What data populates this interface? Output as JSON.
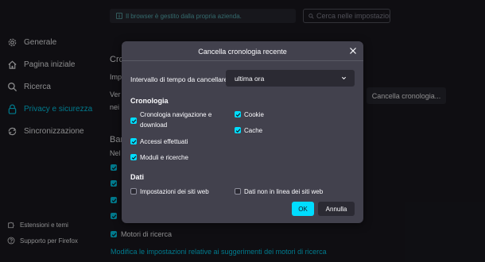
{
  "topbar": {
    "managed_notice": "Il browser è gestito dalla propria azienda.",
    "search_placeholder": "Cerca nelle impostazioni"
  },
  "sidebar": {
    "items": [
      {
        "label": "Generale",
        "icon": "gear-icon"
      },
      {
        "label": "Pagina iniziale",
        "icon": "home-icon"
      },
      {
        "label": "Ricerca",
        "icon": "search-icon"
      },
      {
        "label": "Privacy e sicurezza",
        "icon": "lock-icon",
        "active": true
      },
      {
        "label": "Sincronizzazione",
        "icon": "sync-icon"
      }
    ],
    "bottom": [
      {
        "label": "Estensioni e temi",
        "icon": "puzzle-icon"
      },
      {
        "label": "Supporto per Firefox",
        "icon": "help-icon"
      }
    ]
  },
  "background": {
    "heading_fragment": "Crono",
    "line_impostazioni": "Imp",
    "line_ver": "Ver",
    "line_nei": "nei",
    "clear_history_button": "Cancella cronologia...",
    "bar_fragment": "Bar",
    "nel_fragment": "Nel",
    "search_engines_option": "Motori di ricerca",
    "suggestions_link": "Modifica le impostazioni relative ai suggerimenti dei motori di ricerca"
  },
  "dialog": {
    "title": "Cancella cronologia recente",
    "range_label": "Intervallo di tempo da cancellare:",
    "range_value": "ultima ora",
    "history_section": "Cronologia",
    "history_options": [
      {
        "label": "Cronologia navigazione e download",
        "checked": true
      },
      {
        "label": "Accessi effettuati",
        "checked": true
      },
      {
        "label": "Moduli e ricerche",
        "checked": true
      },
      {
        "label": "Cookie",
        "checked": true
      },
      {
        "label": "Cache",
        "checked": true
      }
    ],
    "data_section": "Dati",
    "data_options": [
      {
        "label": "Impostazioni dei siti web",
        "checked": false
      },
      {
        "label": "Dati non in linea dei siti web",
        "checked": false
      }
    ],
    "ok_label": "OK",
    "cancel_label": "Annulla"
  },
  "colors": {
    "accent": "#00ddff",
    "background": "#1c1b22",
    "dialog": "#42414d"
  }
}
